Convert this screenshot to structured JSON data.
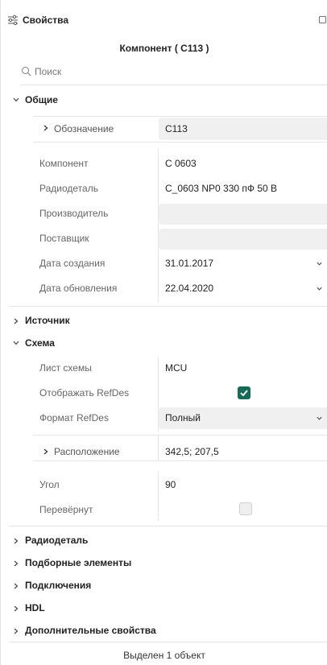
{
  "panel": {
    "title": "Свойства",
    "component_title": "Компонент ( C113 )",
    "search_placeholder": "Поиск",
    "footer": "Выделен 1 объект"
  },
  "groups": {
    "general": {
      "label": "Общие",
      "expanded": true,
      "designator": {
        "label": "Обозначение",
        "value": "C113"
      },
      "component": {
        "label": "Компонент",
        "value": "C 0603"
      },
      "part": {
        "label": "Радиодеталь",
        "value": "C_0603 NP0 330 пФ 50 В"
      },
      "manufacturer": {
        "label": "Производитель",
        "value": ""
      },
      "supplier": {
        "label": "Поставщик",
        "value": ""
      },
      "created": {
        "label": "Дата создания",
        "value": "31.01.2017"
      },
      "updated": {
        "label": "Дата обновления",
        "value": "22.04.2020"
      }
    },
    "source": {
      "label": "Источник",
      "expanded": false
    },
    "schematic": {
      "label": "Схема",
      "expanded": true,
      "sheet": {
        "label": "Лист схемы",
        "value": "MCU"
      },
      "show_refdes": {
        "label": "Отображать RefDes",
        "checked": true
      },
      "refdes_format": {
        "label": "Формат RefDes",
        "value": "Полный"
      },
      "location": {
        "label": "Расположение",
        "value": "342,5; 207,5"
      },
      "angle": {
        "label": "Угол",
        "value": "90"
      },
      "flipped": {
        "label": "Перевёрнут",
        "checked": false
      }
    },
    "collapsed": [
      {
        "label": "Радиодеталь"
      },
      {
        "label": "Подборные элементы"
      },
      {
        "label": "Подключения"
      },
      {
        "label": "HDL"
      },
      {
        "label": "Дополнительные свойства"
      }
    ]
  },
  "colors": {
    "accent_check": "#176b56",
    "field_bg": "#f0f0f0",
    "divider": "#e5e5e5"
  },
  "icons": {
    "panel": "sliders-icon",
    "maximize": "square-icon",
    "search": "search-icon",
    "expand": "chevron-right-icon",
    "collapse": "chevron-down-icon",
    "dropdown": "chevron-down-icon"
  }
}
